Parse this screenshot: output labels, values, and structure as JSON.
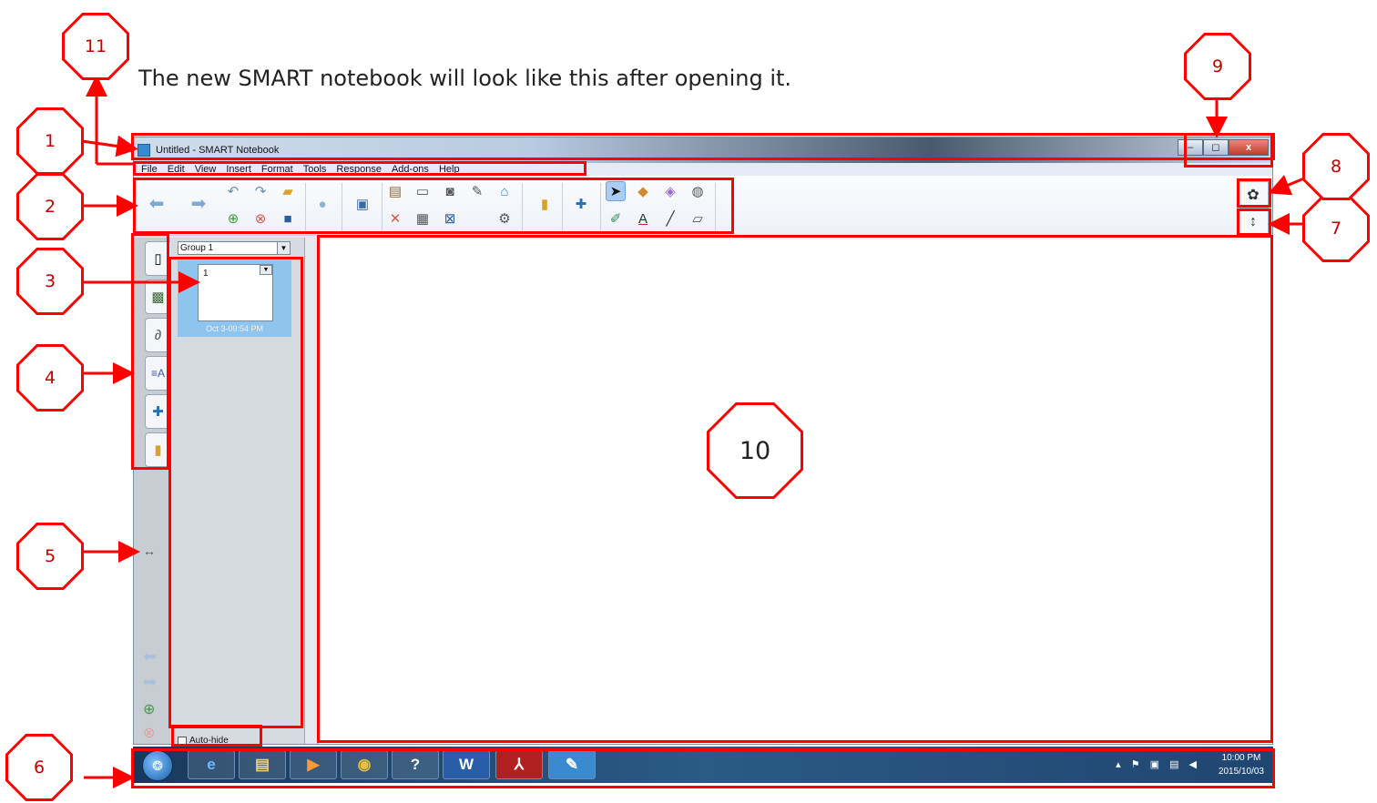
{
  "intro": "The new SMART notebook will look like this after opening it.",
  "window": {
    "title": "Untitled - SMART Notebook",
    "buttons": {
      "minimize": "–",
      "maximize": "◻",
      "close": "x"
    }
  },
  "menu": [
    "File",
    "Edit",
    "View",
    "Insert",
    "Format",
    "Tools",
    "Response",
    "Add-ons",
    "Help"
  ],
  "toolbar": {
    "icons": [
      "back-arrow-icon",
      "forward-arrow-icon",
      "undo-icon",
      "redo-icon",
      "open-file-icon",
      "add-page-icon",
      "delete-page-icon",
      "save-icon",
      "paste-icon",
      "screen-shade-icon",
      "show-all-icon",
      "table-icon",
      "capture-icon",
      "clear-icon",
      "document-camera-icon",
      "delete-icon",
      "pen-tool-icon",
      "shape-icon",
      "eraser-icon",
      "fill-icon",
      "select-icon",
      "pens-icon",
      "text-icon",
      "line-icon",
      "magic-eraser-icon"
    ],
    "settings_icon": "gear-icon",
    "collapse_icon": "up-down-arrow-icon"
  },
  "sorter": {
    "group": "Group 1",
    "page_number": "1",
    "page_date": "Oct 3-09:54 PM",
    "autohide": "Auto-hide"
  },
  "taskbar": {
    "apps": [
      "start-orb",
      "internet-explorer",
      "file-explorer",
      "media-player",
      "chrome",
      "help",
      "word",
      "acrobat",
      "smart-notebook"
    ],
    "app_glyphs": [
      "❂",
      "e",
      "▤",
      "▶",
      "◉",
      "?",
      "W",
      "⅄",
      "✎"
    ],
    "time": "10:00 PM",
    "date": "2015/10/03"
  },
  "annotations": [
    "1",
    "2",
    "3",
    "4",
    "5",
    "6",
    "7",
    "8",
    "9",
    "10",
    "11"
  ],
  "colors": {
    "annotation": "#ff0000",
    "selection": "#8fc4ee"
  }
}
